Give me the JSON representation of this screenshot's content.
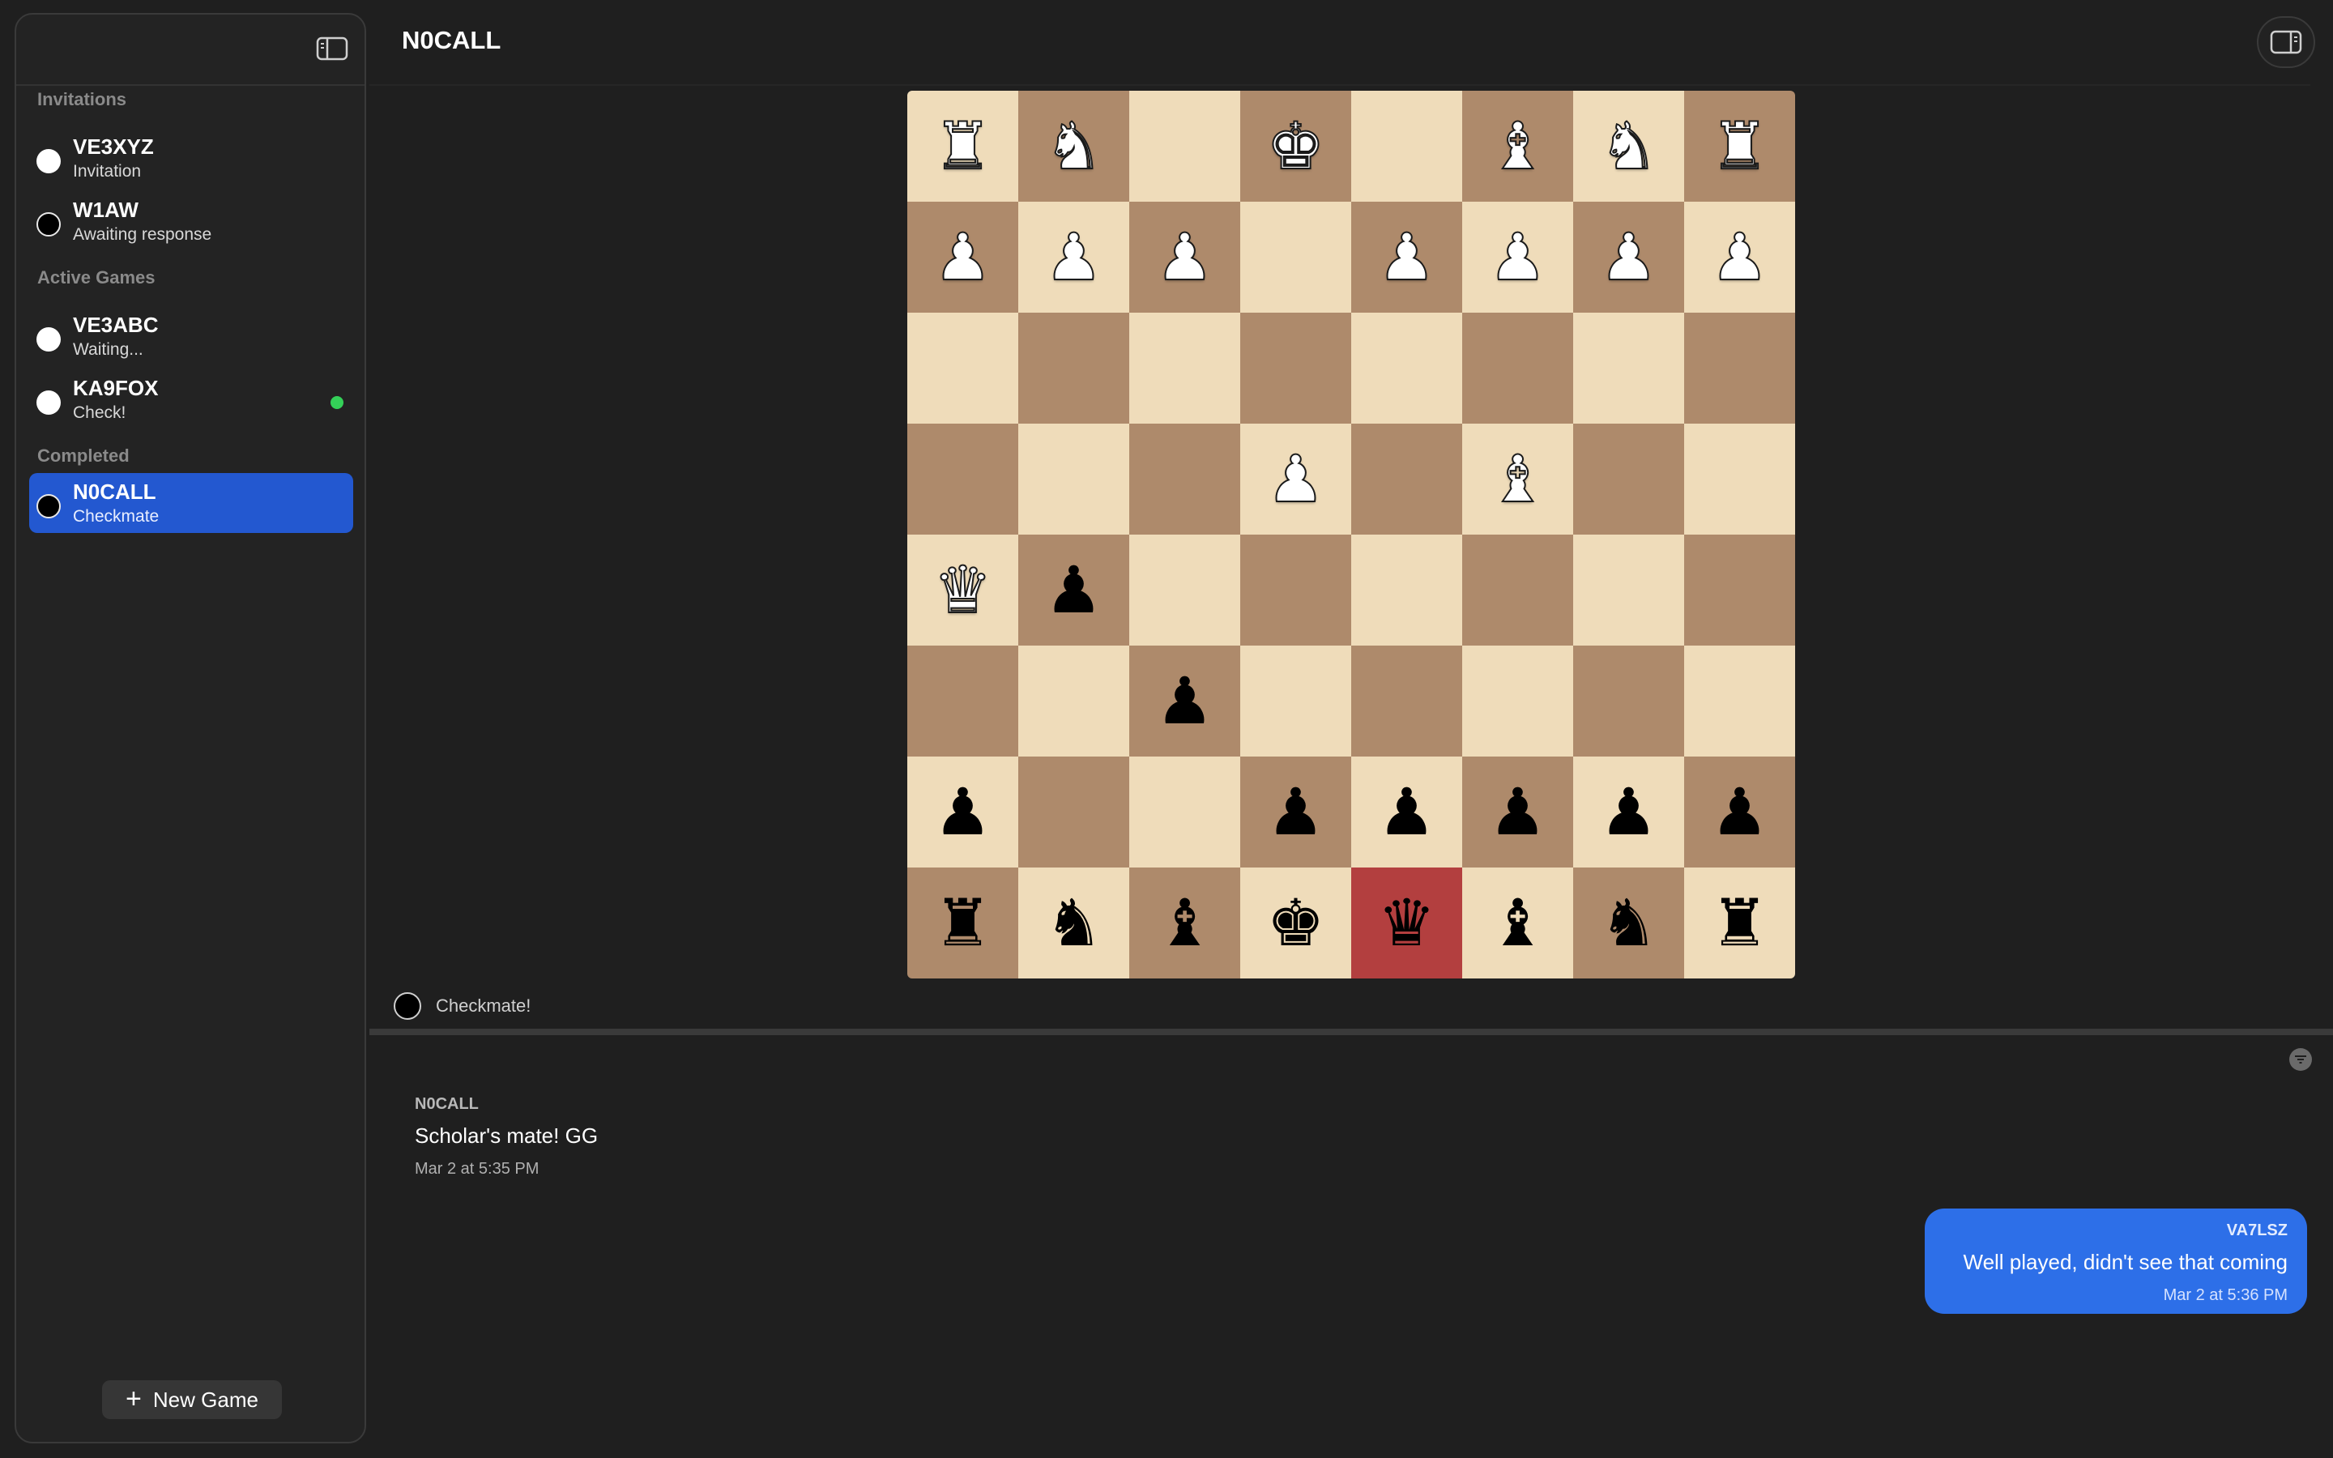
{
  "header": {
    "title": "N0CALL"
  },
  "sidebar": {
    "sections": {
      "invitations": "Invitations",
      "active": "Active Games",
      "completed": "Completed"
    },
    "invitations": [
      {
        "callsign": "VE3XYZ",
        "status": "Invitation",
        "color": "white"
      },
      {
        "callsign": "W1AW",
        "status": "Awaiting response",
        "color": "black"
      }
    ],
    "active": [
      {
        "callsign": "VE3ABC",
        "status": "Waiting...",
        "color": "white"
      },
      {
        "callsign": "KA9FOX",
        "status": "Check!",
        "color": "white",
        "online": true
      }
    ],
    "completed": [
      {
        "callsign": "N0CALL",
        "status": "Checkmate",
        "color": "black",
        "selected": true
      }
    ],
    "new_game_label": "New Game"
  },
  "board": {
    "light_color": "#efdcba",
    "dark_color": "#ae8a6b",
    "check_color": "#b33f3f",
    "check_square": "d1",
    "rows": [
      [
        "wR",
        "wN",
        "",
        "wK",
        "",
        "wB",
        "wN",
        "wR"
      ],
      [
        "wP",
        "wP",
        "wP",
        "",
        "wP",
        "wP",
        "wP",
        "wP"
      ],
      [
        "",
        "",
        "",
        "",
        "",
        "",
        "",
        ""
      ],
      [
        "",
        "",
        "",
        "wP",
        "",
        "wB",
        "",
        ""
      ],
      [
        "wQ",
        "bP",
        "",
        "",
        "",
        "",
        "",
        ""
      ],
      [
        "",
        "",
        "bP",
        "",
        "",
        "",
        "",
        ""
      ],
      [
        "bP",
        "",
        "",
        "bP",
        "bP",
        "bP",
        "bP",
        "bP"
      ],
      [
        "bR",
        "bN",
        "bB",
        "bK",
        "bQ",
        "bB",
        "bN",
        "bR"
      ]
    ]
  },
  "game_status": {
    "text": "Checkmate!"
  },
  "chat": {
    "messages": [
      {
        "direction": "in",
        "sender": "N0CALL",
        "body": "Scholar's mate! GG",
        "time": "Mar 2 at 5:35 PM"
      },
      {
        "direction": "out",
        "sender": "VA7LSZ",
        "body": "Well played, didn't see that coming",
        "time": "Mar 2 at 5:36 PM"
      }
    ]
  },
  "colors": {
    "accent": "#2358d0",
    "bubble": "#2d6fe8",
    "online": "#34d058"
  }
}
